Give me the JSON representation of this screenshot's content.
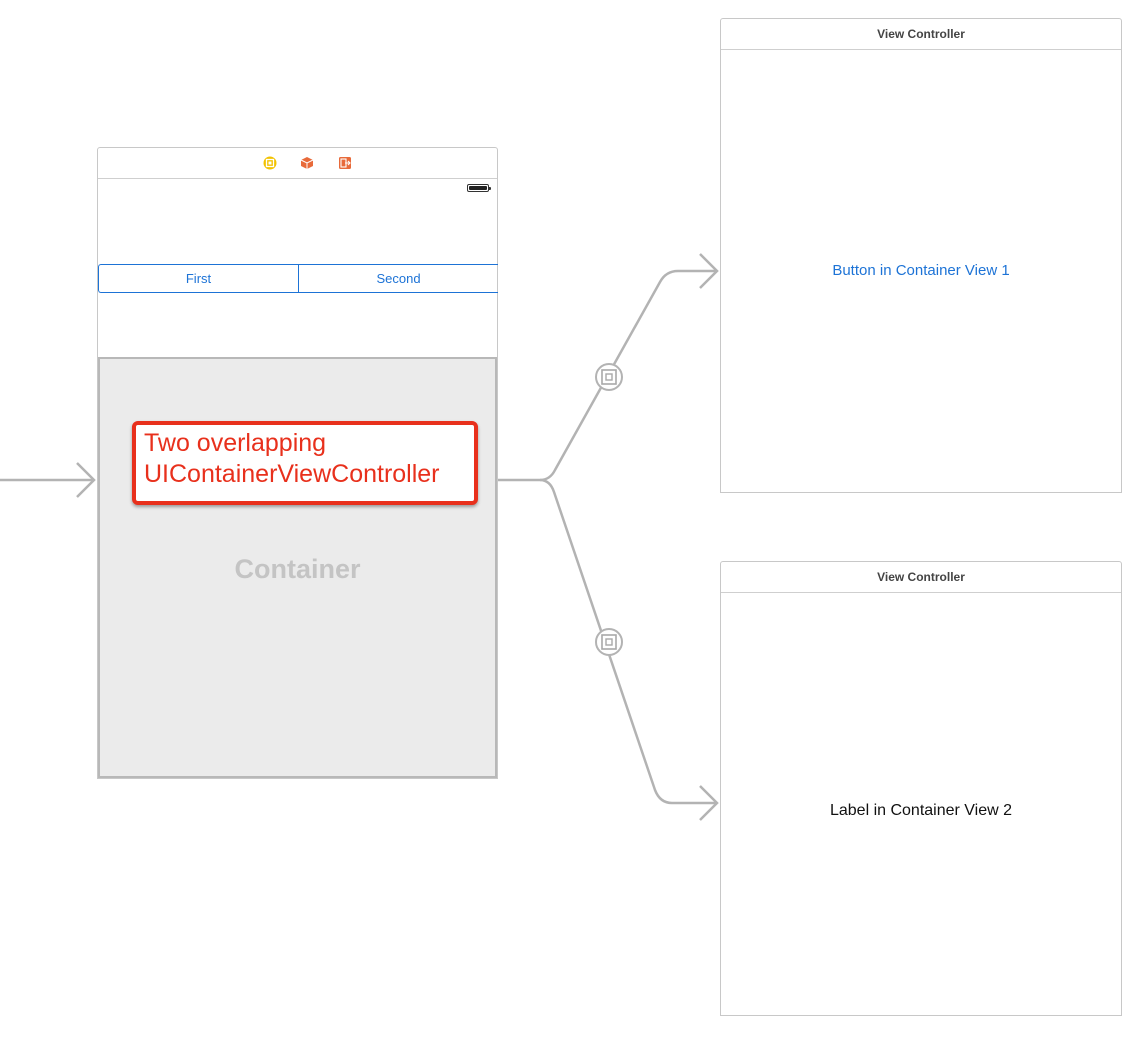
{
  "main_scene": {
    "dock_icons": [
      "view-controller-icon",
      "first-responder-icon",
      "exit-icon"
    ],
    "segmented_control": {
      "segments": [
        "First",
        "Second"
      ]
    },
    "container_view": {
      "label": "Container"
    },
    "annotation": {
      "line1": "Two overlapping",
      "line2": "UIContainerViewController"
    }
  },
  "scene_top": {
    "title": "View Controller",
    "button_label": "Button in Container View 1"
  },
  "scene_bottom": {
    "title": "View Controller",
    "label_text": "Label in Container View 2"
  },
  "colors": {
    "accent_blue": "#1d73d6",
    "annotation_red": "#e8301c",
    "container_gray": "#ebebeb",
    "segue_gray": "#b3b3b3",
    "dock_yellow": "#f2c200",
    "dock_orange": "#e86a3a"
  }
}
